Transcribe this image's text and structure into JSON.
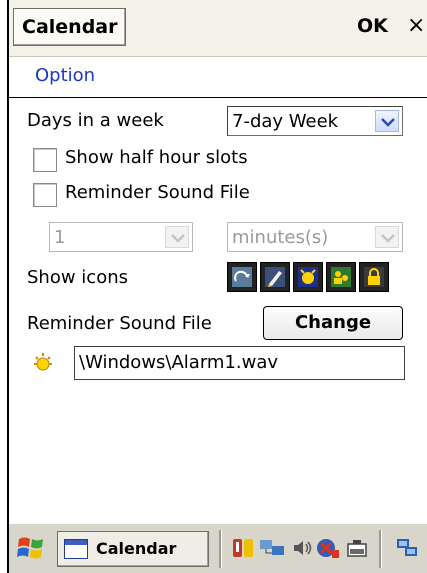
{
  "window": {
    "title": "Calendar",
    "ok_label": "OK",
    "close_label": "×"
  },
  "menu": {
    "option_label": "Option"
  },
  "settings": {
    "days_label": "Days in a week",
    "days_value": "7-day Week",
    "show_half_hour": {
      "label": "Show half hour slots",
      "checked": false
    },
    "reminder_checkbox": {
      "label": "Reminder Sound File",
      "checked": false
    },
    "reminder_amount": "1",
    "reminder_unit": "minutes(s)",
    "show_icons_label": "Show icons",
    "icons": [
      "recurrence-icon",
      "note-icon",
      "reminder-icon",
      "attendees-icon",
      "private-icon"
    ],
    "sound_file_label": "Reminder Sound File",
    "change_label": "Change",
    "sound_file_path": "\\Windows\\Alarm1.wav"
  },
  "taskbar": {
    "app_label": "Calendar",
    "tray_icons": [
      "sync-icon",
      "network-icon",
      "volume-icon",
      "connectivity-icon",
      "battery-icon",
      "desktop-switch-icon"
    ]
  },
  "colors": {
    "menu_text": "#1a37c8",
    "titlebar": "#f4f1e8",
    "taskbar": "#d8d5ca"
  }
}
